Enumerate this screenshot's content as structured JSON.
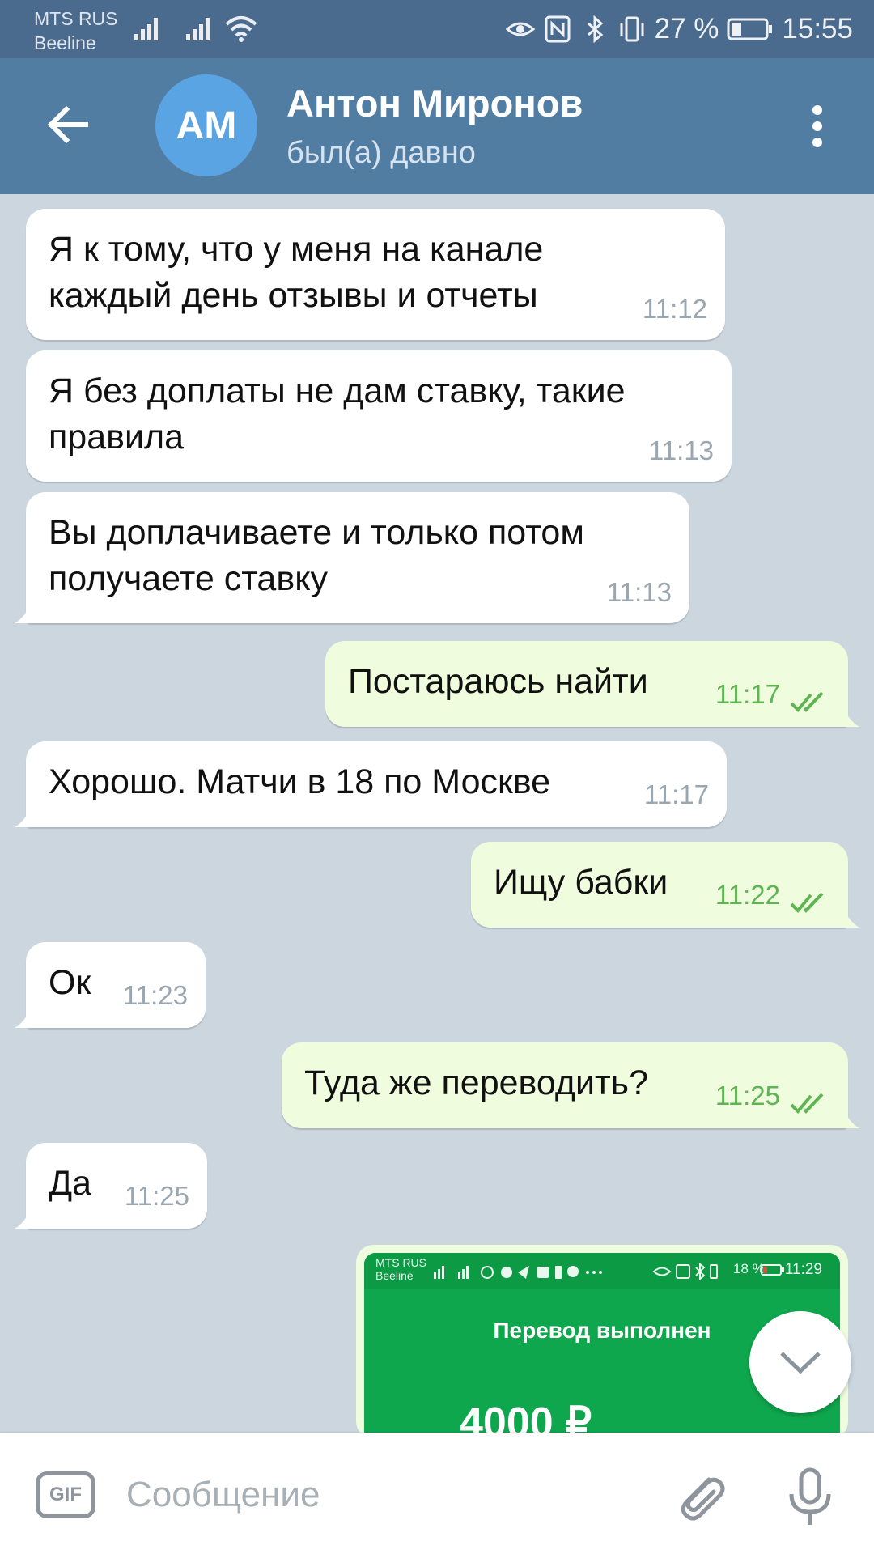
{
  "status_bar": {
    "carrier_1": "MTS RUS",
    "carrier_2": "Beeline",
    "battery": "27 %",
    "time": "15:55"
  },
  "header": {
    "avatar_initials": "АМ",
    "name": "Антон Миронов",
    "status": "был(а) давно"
  },
  "messages": [
    {
      "dir": "in",
      "lines": [
        "Я к тому, что у меня на канале",
        "каждый день отзывы и отчеты"
      ],
      "time": "11:12"
    },
    {
      "dir": "in",
      "lines": [
        "Я без доплаты не дам ставку, такие",
        "правила"
      ],
      "time": "11:13"
    },
    {
      "dir": "in",
      "lines": [
        "Вы доплачиваете и только потом",
        "получаете ставку"
      ],
      "time": "11:13"
    },
    {
      "dir": "out",
      "lines": [
        "Постараюсь найти"
      ],
      "time": "11:17",
      "read": true
    },
    {
      "dir": "in",
      "lines": [
        "Хорошо. Матчи в 18 по Москве"
      ],
      "time": "11:17"
    },
    {
      "dir": "out",
      "lines": [
        "Ищу бабки"
      ],
      "time": "11:22",
      "read": true
    },
    {
      "dir": "in",
      "lines": [
        "Ок"
      ],
      "time": "11:23"
    },
    {
      "dir": "out",
      "lines": [
        "Туда же переводить?"
      ],
      "time": "11:25",
      "read": true
    },
    {
      "dir": "in",
      "lines": [
        "Да"
      ],
      "time": "11:25"
    }
  ],
  "photo_message": {
    "carrier_1": "MTS RUS",
    "carrier_2": "Beeline",
    "battery": "18 %",
    "time": "11:29",
    "title": "Перевод выполнен",
    "amount": "4000 ₽"
  },
  "composer": {
    "gif_label": "GIF",
    "placeholder": "Сообщение"
  },
  "colors": {
    "status_bar": "#4a6a8e",
    "app_bar": "#527da3",
    "avatar": "#5aa4e3",
    "chat_bg": "#cbd6df",
    "incoming_bubble": "#ffffff",
    "outgoing_bubble": "#effdde",
    "outgoing_time": "#5fb453",
    "payment_green": "#0fa74d"
  }
}
